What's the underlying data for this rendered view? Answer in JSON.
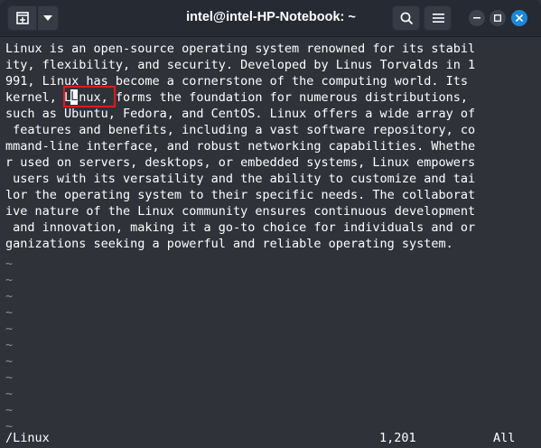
{
  "window": {
    "title": "intel@intel-HP-Notebook: ~"
  },
  "toolbar": {
    "new_tab_icon": "new-tab-icon",
    "menu_icon": "chevron-down-icon",
    "search_icon": "search-icon",
    "hamburger_icon": "hamburger-menu-icon"
  },
  "window_controls": [
    "minimize",
    "maximize",
    "close"
  ],
  "terminal": {
    "lines": [
      "Linux is an open-source operating system renowned for its stabil",
      "ity, flexibility, and security. Developed by Linus Torvalds in 1",
      "991, Linux has become a cornerstone of the computing world. Its",
      "kernel, Linux, forms the foundation for numerous distributions,",
      "such as Ubuntu, Fedora, and CentOS. Linux offers a wide array of",
      " features and benefits, including a vast software repository, co",
      "mmand-line interface, and robust networking capabilities. Whethe",
      "r used on servers, desktops, or embedded systems, Linux empowers",
      " users with its versatility and the ability to customize and tai",
      "lor the operating system to their specific needs. The collaborat",
      "ive nature of the Linux community ensures continuous development",
      " and innovation, making it a go-to choice for individuals and or",
      "ganizations seeking a powerful and reliable operating system."
    ],
    "cursor_char": "L",
    "tilde": "~",
    "empty_line_count": 11
  },
  "status": {
    "search": "/Linux",
    "position": "1,201",
    "scroll": "All"
  },
  "colors": {
    "background": "#2f3239",
    "titlebar": "#262a33",
    "text": "#ffffff",
    "highlight_border": "#e01b1b",
    "close_button": "#1b88d8"
  }
}
